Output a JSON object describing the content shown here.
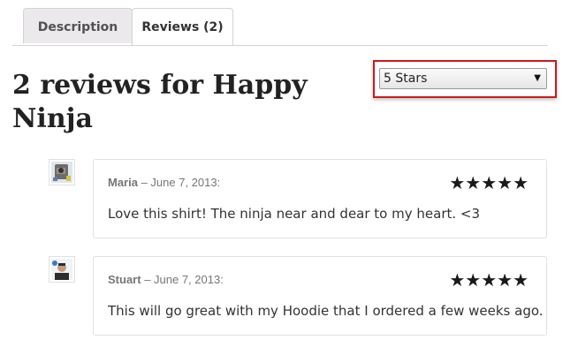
{
  "tabs": [
    {
      "label": "Description",
      "active": false
    },
    {
      "label": "Reviews (2)",
      "active": true
    }
  ],
  "heading": "2 reviews for Happy Ninja",
  "filter": {
    "selected": "5 Stars"
  },
  "reviews": [
    {
      "author": "Maria",
      "date": "– June 7, 2013:",
      "rating": 5,
      "stars": "★★★★★",
      "text": "Love this shirt! The ninja near and dear to my heart. <3"
    },
    {
      "author": "Stuart",
      "date": "– June 7, 2013:",
      "rating": 5,
      "stars": "★★★★★",
      "text": "This will go great with my Hoodie that I ordered a few weeks ago."
    }
  ],
  "colors": {
    "highlight_border": "#cc1a1a",
    "tab_inactive_bg": "#ebe9eb",
    "star": "#1a1a1a"
  }
}
